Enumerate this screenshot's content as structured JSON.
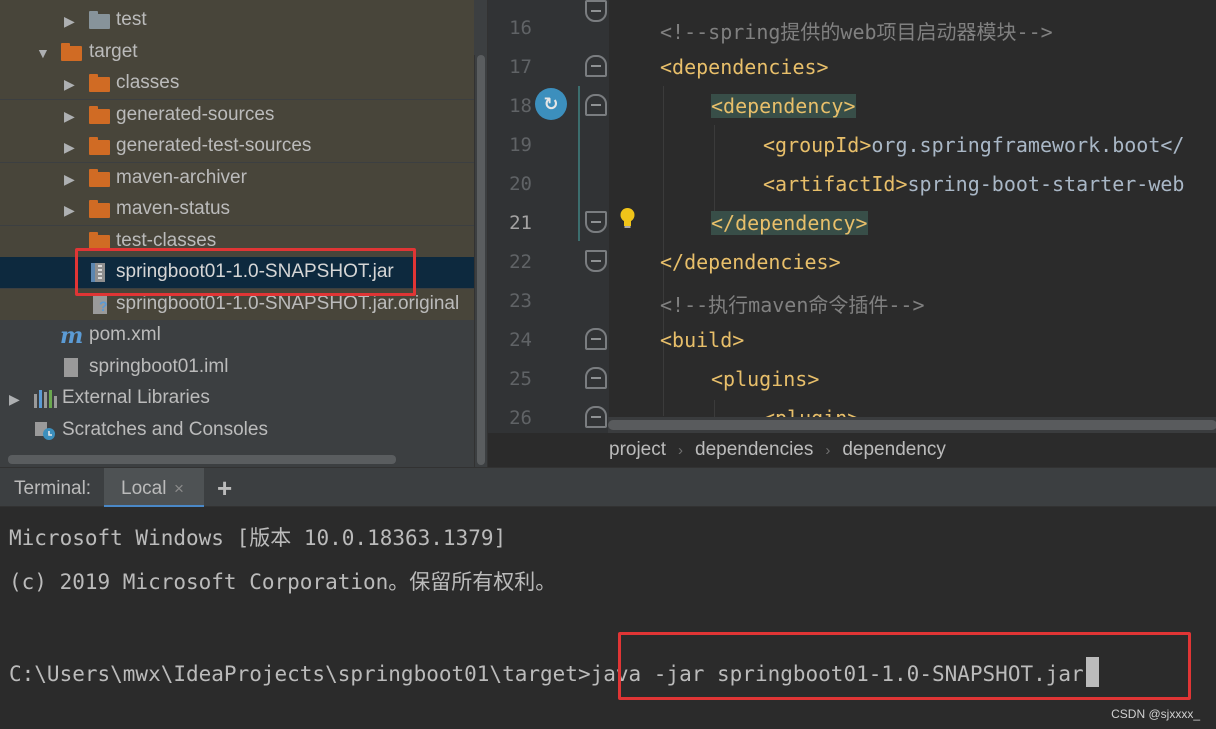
{
  "project_tree": {
    "items": [
      {
        "label": "test",
        "icon": "folder-icon"
      },
      {
        "label": "target",
        "icon": "folder-orange-icon"
      },
      {
        "label": "classes",
        "icon": "folder-orange-icon"
      },
      {
        "label": "generated-sources",
        "icon": "folder-orange-icon"
      },
      {
        "label": "generated-test-sources",
        "icon": "folder-orange-icon"
      },
      {
        "label": "maven-archiver",
        "icon": "folder-orange-icon"
      },
      {
        "label": "maven-status",
        "icon": "folder-orange-icon"
      },
      {
        "label": "test-classes",
        "icon": "folder-orange-icon"
      },
      {
        "label": "springboot01-1.0-SNAPSHOT.jar",
        "icon": "jar-icon"
      },
      {
        "label": "springboot01-1.0-SNAPSHOT.jar.original",
        "icon": "unknown-file-icon"
      },
      {
        "label": "pom.xml",
        "icon": "maven-icon"
      },
      {
        "label": "springboot01.iml",
        "icon": "iml-file-icon"
      },
      {
        "label": "External Libraries",
        "icon": "libraries-icon"
      },
      {
        "label": "Scratches and Consoles",
        "icon": "scratches-icon"
      }
    ]
  },
  "editor": {
    "line_numbers": [
      "16",
      "17",
      "18",
      "19",
      "20",
      "21",
      "22",
      "23",
      "24",
      "25",
      "26"
    ],
    "current_line": "21",
    "lines": {
      "l16_comment": "<!--spring提供的web项目启动器模块-->",
      "l17_open": "<",
      "l17_tag": "dependencies",
      "l17_close": ">",
      "l18_open": "<",
      "l18_tag": "dependency",
      "l18_close": ">",
      "l19_open": "<",
      "l19_tag": "groupId",
      "l19_close": ">",
      "l19_text": "org.springframework.boot</",
      "l20_open": "<",
      "l20_tag": "artifactId",
      "l20_close": ">",
      "l20_text": "spring-boot-starter-web",
      "l21_open": "</",
      "l21_tag": "dependency",
      "l21_close": ">",
      "l22_open": "</",
      "l22_tag": "dependencies",
      "l22_close": ">",
      "l23_comment": "<!--执行maven命令插件-->",
      "l24_open": "<",
      "l24_tag": "build",
      "l24_close": ">",
      "l25_open": "<",
      "l25_tag": "plugins",
      "l25_close": ">",
      "l26_open": "<",
      "l26_tag": "plugin",
      "l26_close": ">"
    }
  },
  "breadcrumbs": [
    "project",
    "dependencies",
    "dependency"
  ],
  "terminal": {
    "title": "Terminal:",
    "tab_label": "Local",
    "tab_close": "×",
    "add_tab": "+",
    "lines": [
      "Microsoft Windows [版本 10.0.18363.1379]",
      "(c) 2019 Microsoft Corporation。保留所有权利。"
    ],
    "prompt": "C:\\Users\\mwx\\IdeaProjects\\springboot01\\target>",
    "command": "java -jar springboot01-1.0-SNAPSHOT.jar"
  },
  "watermark": "CSDN @sjxxxx_",
  "colors": {
    "tree_bg": "#3c3f41",
    "excluded_bg": "#48453a",
    "selection_bg": "#0d293e",
    "editor_bg": "#2b2b2b",
    "xml_tag": "#e8bf6a",
    "comment": "#808080",
    "highlight_box": "#e03535"
  }
}
